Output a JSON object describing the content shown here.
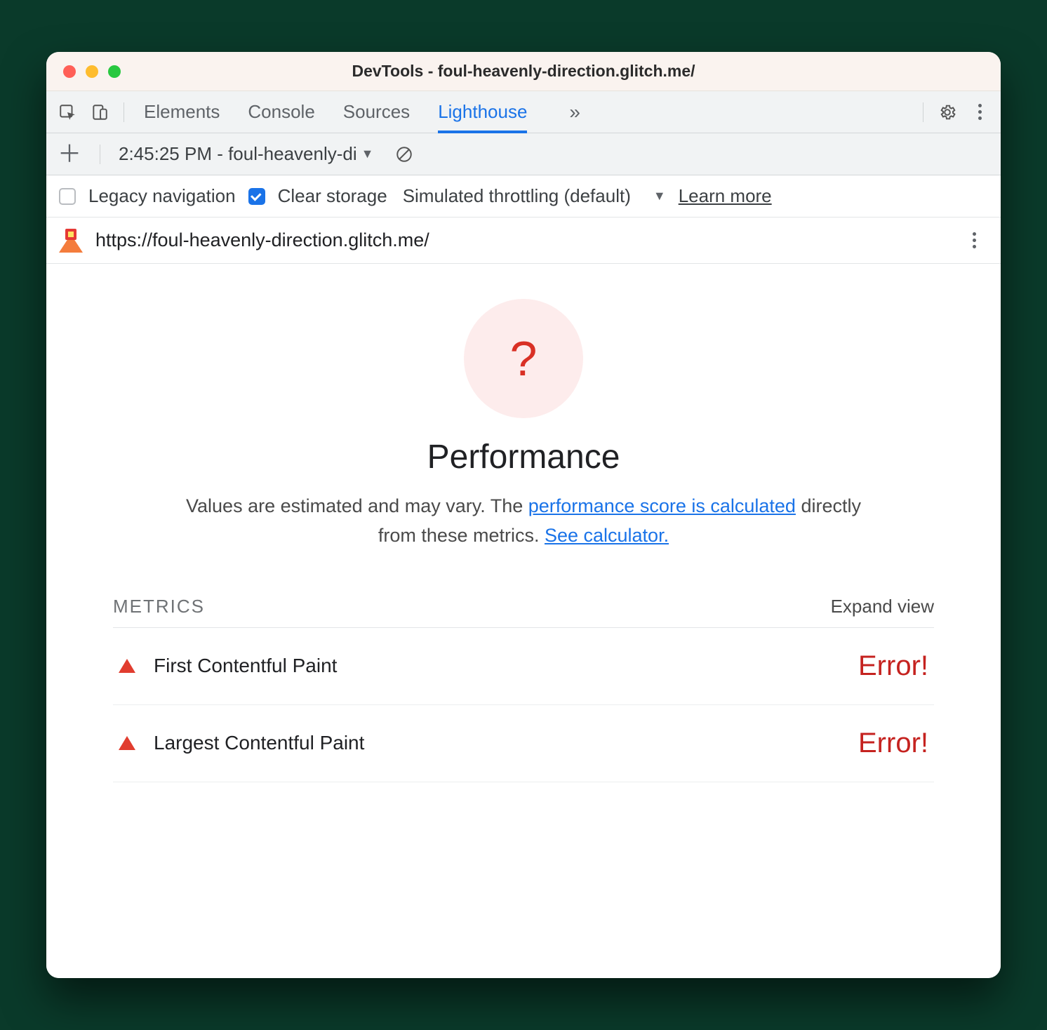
{
  "window": {
    "title": "DevTools - foul-heavenly-direction.glitch.me/"
  },
  "tabs": {
    "items": [
      "Elements",
      "Console",
      "Sources",
      "Lighthouse"
    ],
    "active": "Lighthouse"
  },
  "reportbar": {
    "timestamp_label": "2:45:25 PM - foul-heavenly-di"
  },
  "options": {
    "legacy_label": "Legacy navigation",
    "legacy_checked": false,
    "clear_label": "Clear storage",
    "clear_checked": true,
    "throttling_label": "Simulated throttling (default)",
    "learn_more": "Learn more"
  },
  "urlbar": {
    "url": "https://foul-heavenly-direction.glitch.me/"
  },
  "report": {
    "score_symbol": "?",
    "title": "Performance",
    "desc_prefix": "Values are estimated and may vary. The ",
    "link1": "performance score is calculated",
    "desc_mid": " directly from these metrics. ",
    "link2": "See calculator.",
    "metrics_label": "METRICS",
    "expand_label": "Expand view",
    "metrics": [
      {
        "name": "First Contentful Paint",
        "value": "Error!"
      },
      {
        "name": "Largest Contentful Paint",
        "value": "Error!"
      }
    ]
  }
}
